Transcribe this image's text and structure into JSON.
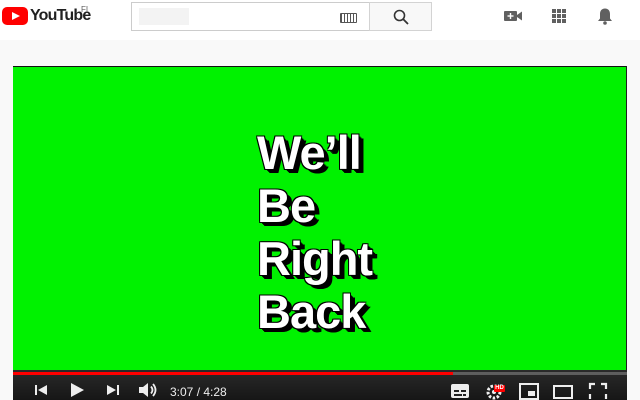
{
  "header": {
    "logo_text": "YouTube",
    "country_code": "FI",
    "search": {
      "value": "",
      "placeholder": ""
    },
    "icons": [
      "video-camera-icon",
      "apps-grid-icon",
      "bell-icon"
    ]
  },
  "player": {
    "message_lines": [
      "We’ll",
      "Be",
      "Right",
      "Back"
    ],
    "background_color": "#00f200",
    "progress_fraction": 0.716,
    "current_time": "3:07",
    "separator": " / ",
    "duration": "4:28",
    "hd_badge": "HD",
    "controls": [
      "previous-icon",
      "play-icon",
      "next-icon",
      "volume-icon",
      "subtitles-icon",
      "settings-icon",
      "miniplayer-icon",
      "theater-mode-icon",
      "fullscreen-icon"
    ]
  },
  "colors": {
    "brand_red": "#ff0000",
    "progress_red": "#ff0000",
    "screen_green": "#00f200"
  }
}
